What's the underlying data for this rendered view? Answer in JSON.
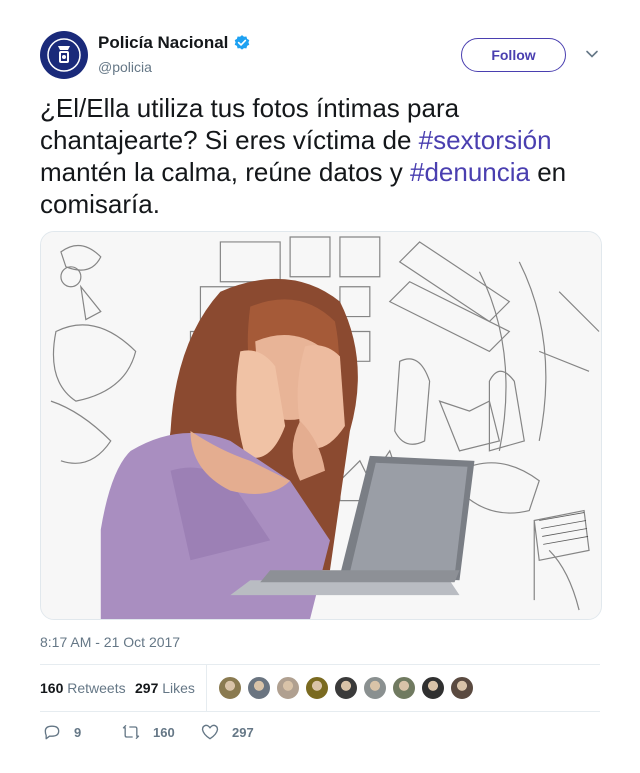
{
  "author": {
    "display_name": "Policía Nacional",
    "handle": "@policia",
    "verified": true,
    "avatar_icon": "police-badge-icon"
  },
  "follow_label": "Follow",
  "tweet": {
    "segments": [
      {
        "text": "¿El/Ella utiliza tus fotos íntimas para chantajearte? Si eres víctima de ",
        "type": "text"
      },
      {
        "text": "#sextorsión",
        "type": "hashtag"
      },
      {
        "text": " mantén la calma, reúne datos y ",
        "type": "text"
      },
      {
        "text": "#denuncia",
        "type": "hashtag"
      },
      {
        "text": " en comisaría.",
        "type": "text"
      }
    ]
  },
  "timestamp": "8:17 AM - 21 Oct 2017",
  "stats": {
    "retweets_count": "160",
    "retweets_label": "Retweets",
    "likes_count": "297",
    "likes_label": "Likes"
  },
  "likers": [
    "#8a7a50",
    "#6a7480",
    "#b0a090",
    "#7a6a20",
    "#3a3a3a",
    "#8a9090",
    "#707a60",
    "#303030",
    "#5a4a40"
  ],
  "actions": {
    "reply_count": "9",
    "retweet_count": "160",
    "like_count": "297"
  },
  "colors": {
    "accent": "#4a3fb0",
    "verified": "#1da1f2",
    "muted": "#657786"
  }
}
